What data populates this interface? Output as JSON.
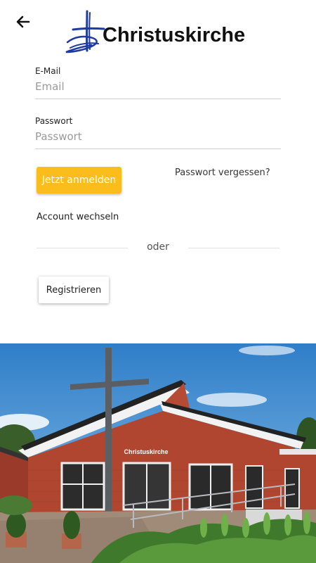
{
  "header": {
    "back_icon": "arrow-left-icon",
    "logo_text": "Christuskirche"
  },
  "form": {
    "email_label": "E-Mail",
    "email_placeholder": "Email",
    "password_label": "Passwort",
    "password_placeholder": "Passwort",
    "login_button": "Jetzt anmelden",
    "forgot_link": "Passwort vergessen?",
    "switch_account": "Account wechseln",
    "divider": "oder",
    "register_button": "Registrieren"
  },
  "photo": {
    "sign_text": "Christuskirche"
  },
  "colors": {
    "accent": "#fbbd1b",
    "logo_blue": "#1f3aa0"
  }
}
